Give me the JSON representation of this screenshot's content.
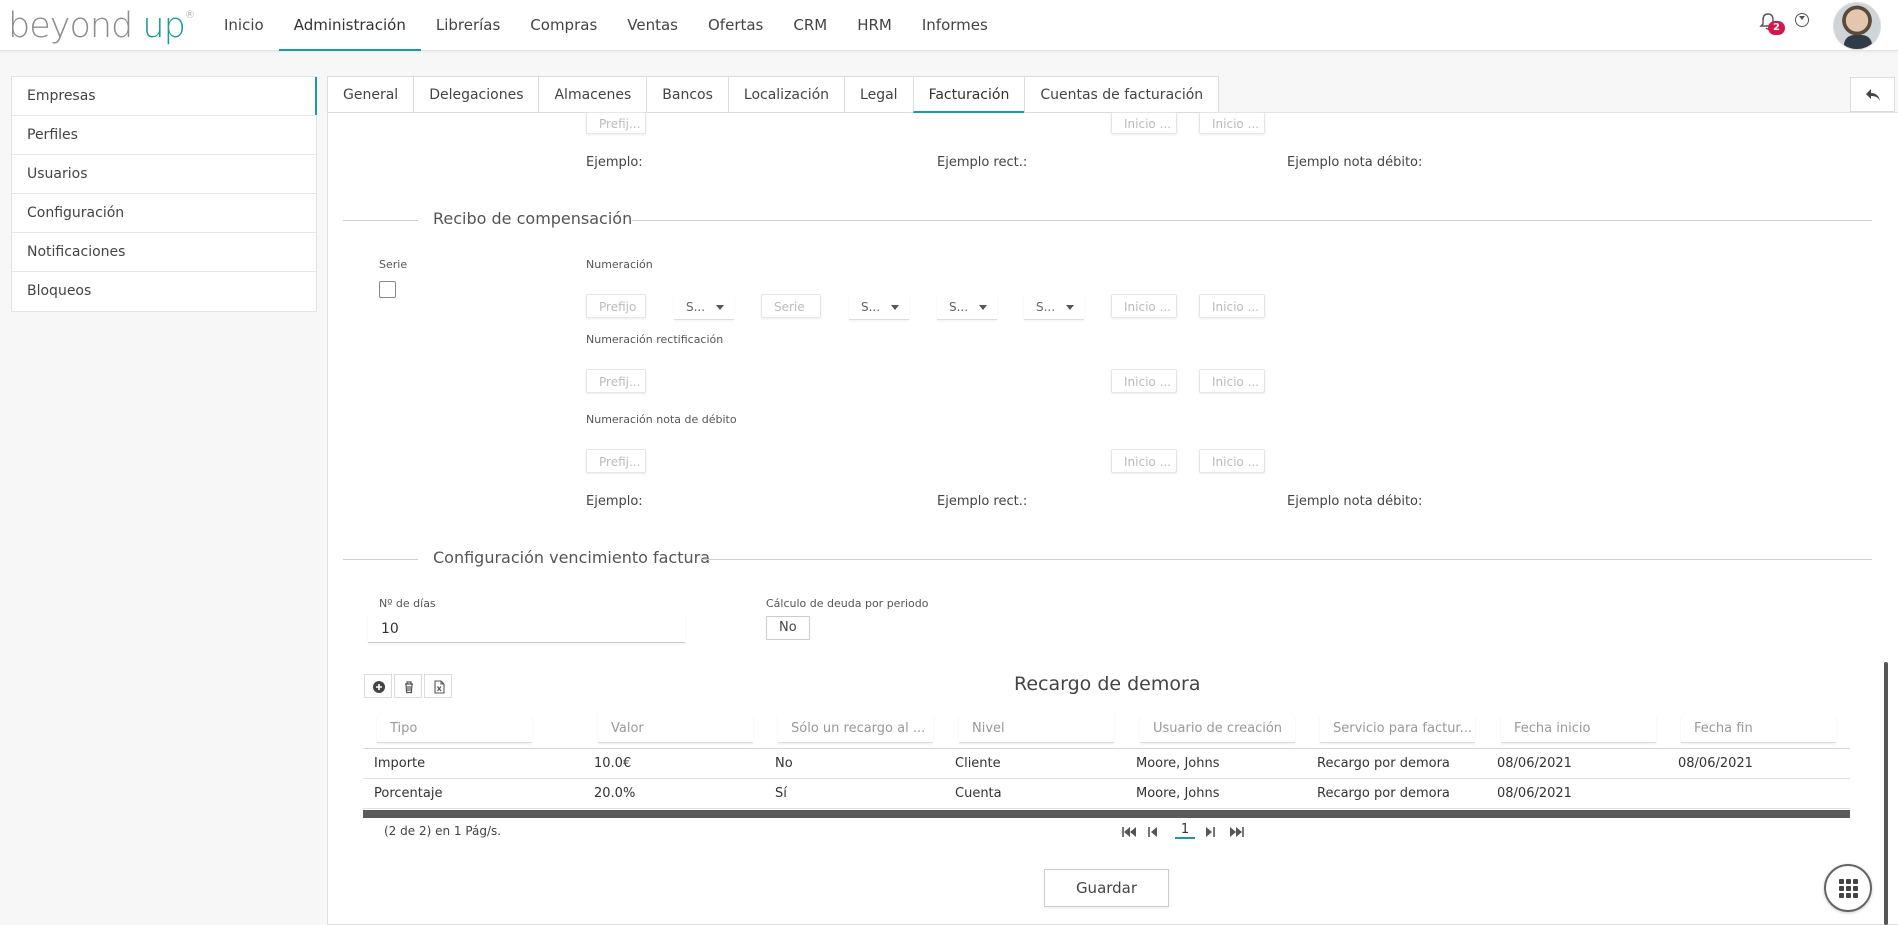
{
  "logo": {
    "text": "beyond",
    "accent": "up",
    "mark": "®"
  },
  "nav": {
    "items": [
      "Inicio",
      "Administración",
      "Librerías",
      "Compras",
      "Ventas",
      "Ofertas",
      "CRM",
      "HRM",
      "Informes"
    ],
    "active": "Administración"
  },
  "header": {
    "notifications_count": "2"
  },
  "sidebar": {
    "items": [
      "Empresas",
      "Perfiles",
      "Usuarios",
      "Configuración",
      "Notificaciones",
      "Bloqueos"
    ],
    "active": "Empresas"
  },
  "tabs": {
    "items": [
      "General",
      "Delegaciones",
      "Almacenes",
      "Bancos",
      "Localización",
      "Legal",
      "Facturación",
      "Cuentas de facturación"
    ],
    "active": "Facturación"
  },
  "top_partial": {
    "prefix_placeholder": "Prefij...",
    "start1_placeholder": "Inicio ...",
    "start2_placeholder": "Inicio ...",
    "example": "Ejemplo:",
    "example_rect": "Ejemplo rect.:",
    "example_debit": "Ejemplo nota débito:"
  },
  "recibo": {
    "title": "Recibo de compensación",
    "serie_label": "Serie",
    "numeracion_label": "Numeración",
    "prefijo_placeholder": "Prefijo",
    "s1": "S...",
    "serie_placeholder": "Serie",
    "s2": "S...",
    "s3": "S...",
    "s4": "S...",
    "inicio1": "Inicio ...",
    "inicio2": "Inicio ...",
    "rect_label": "Numeración rectificación",
    "rect_prefix": "Prefij...",
    "rect_inicio1": "Inicio ...",
    "rect_inicio2": "Inicio ...",
    "debit_label": "Numeración nota de débito",
    "debit_prefix": "Prefij...",
    "debit_inicio1": "Inicio ...",
    "debit_inicio2": "Inicio ...",
    "example": "Ejemplo:",
    "example_rect": "Ejemplo rect.:",
    "example_debit": "Ejemplo nota débito:"
  },
  "vencimiento": {
    "title": "Configuración vencimiento factura",
    "dias_label": "Nº de días",
    "dias_value": "10",
    "calculo_label": "Cálculo de deuda por periodo",
    "calculo_value": "No"
  },
  "recargo": {
    "title": "Recargo de demora",
    "filters": [
      "Tipo",
      "Valor",
      "Sólo un recargo al ...",
      "Nivel",
      "Usuario de creación",
      "Servicio para factur...",
      "Fecha inicio",
      "Fecha fin"
    ],
    "rows": [
      [
        "Importe",
        "10.0€",
        "No",
        "Cliente",
        "Moore, Johns",
        "Recargo por demora",
        "08/06/2021",
        "08/06/2021"
      ],
      [
        "Porcentaje",
        "20.0%",
        "Sí",
        "Cuenta",
        "Moore, Johns",
        "Recargo por demora",
        "08/06/2021",
        ""
      ]
    ],
    "pager_info": "(2 de 2) en 1 Pág/s.",
    "page": "1"
  },
  "save_label": "Guardar",
  "colors": {
    "accent": "#1b9c9c",
    "badge": "#d6174b"
  }
}
